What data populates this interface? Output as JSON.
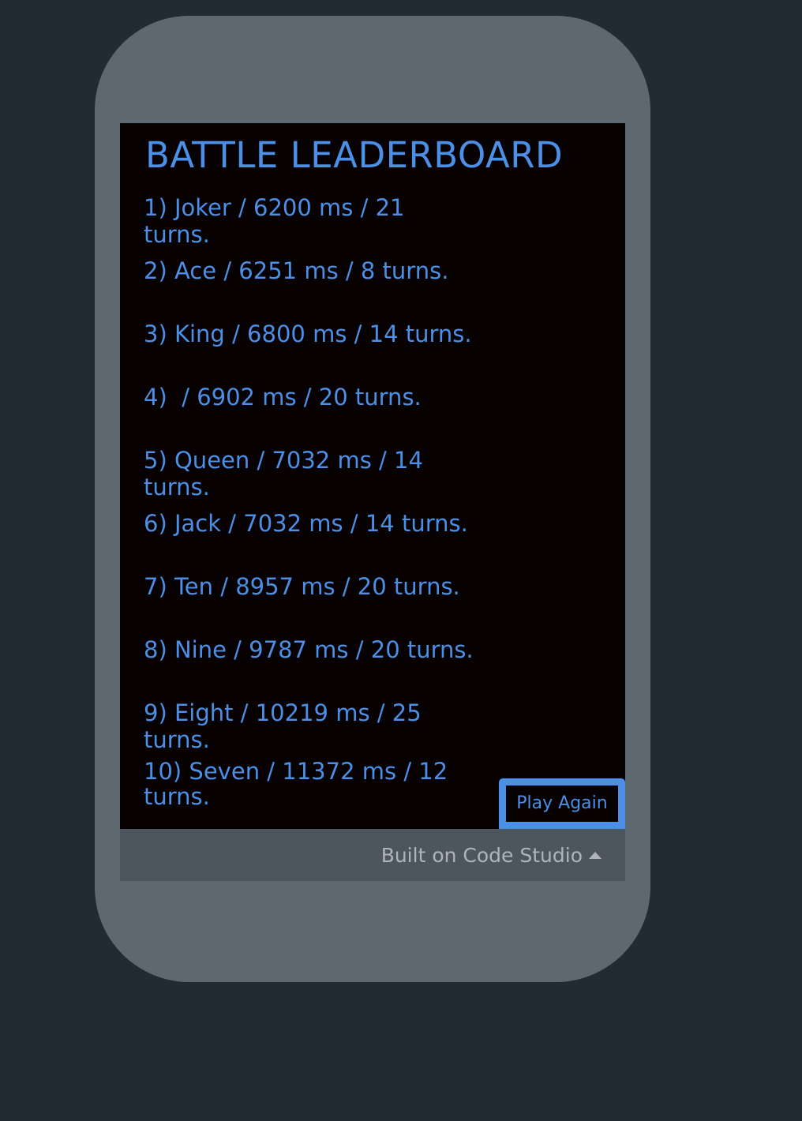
{
  "leaderboard": {
    "title": "BATTLE LEADERBOARD",
    "entries": [
      "1) Joker / 6200 ms / 21 turns.",
      "2) Ace / 6251 ms / 8 turns.",
      "3) King / 6800 ms / 14 turns.",
      "4)  / 6902 ms / 20 turns.",
      "5) Queen / 7032 ms / 14 turns.",
      "6) Jack / 7032 ms / 14 turns.",
      "7) Ten / 8957 ms / 20 turns.",
      "8) Nine / 9787 ms / 20 turns.",
      "9) Eight / 10219 ms / 25 turns.",
      "10) Seven / 11372 ms / 12 turns."
    ],
    "play_again_label": "Play Again"
  },
  "footer": {
    "label": "Built on Code Studio",
    "icon": "caret-up-icon"
  },
  "colors": {
    "page_background": "#222a33",
    "device_frame": "#5d6870",
    "screen_background": "#080102",
    "accent_text": "#4b8fe6",
    "footer_background": "#4d565e",
    "footer_text": "#aeb4b9"
  }
}
